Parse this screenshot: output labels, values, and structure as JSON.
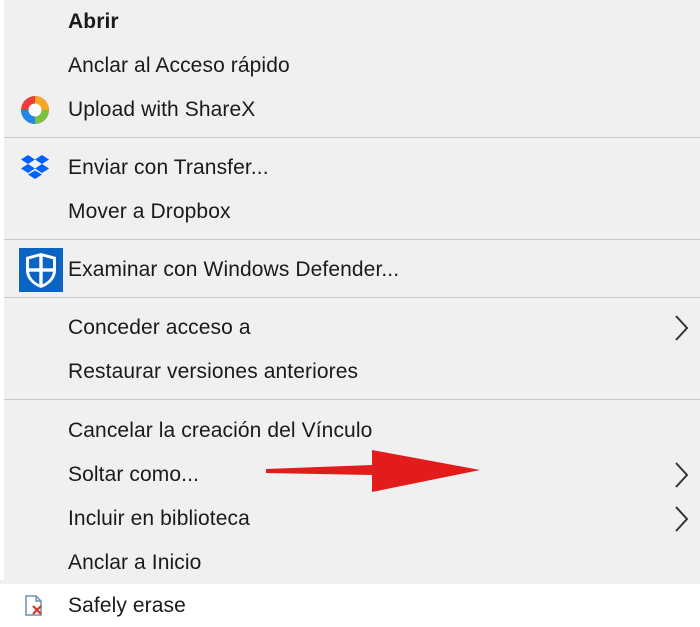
{
  "menu": {
    "items": [
      {
        "label": "Abrir"
      },
      {
        "label": "Anclar al Acceso rápido"
      },
      {
        "label": "Upload with ShareX",
        "icon": "sharex-icon"
      },
      {
        "label": "Enviar con Transfer...",
        "icon": "dropbox-icon"
      },
      {
        "label": "Mover a Dropbox"
      },
      {
        "label": "Examinar con Windows Defender...",
        "icon": "windows-defender-shield-icon"
      },
      {
        "label": "Conceder acceso a",
        "submenu": true
      },
      {
        "label": "Restaurar versiones anteriores"
      },
      {
        "label": "Cancelar la creación del Vínculo"
      },
      {
        "label": "Soltar como...",
        "submenu": true
      },
      {
        "label": "Incluir en biblioteca",
        "submenu": true
      },
      {
        "label": "Anclar a Inicio"
      },
      {
        "label": "Safely erase",
        "icon": "safely-erase-icon"
      }
    ]
  },
  "annotation": {
    "arrow_icon": "red-arrow-icon",
    "arrow_color": "#e21b1b"
  },
  "colors": {
    "menu_background": "#f0f0f0",
    "separator": "#c8c8c8",
    "text": "#1a1a1a",
    "dropbox_blue": "#0061fe",
    "defender_blue": "#0a64c2",
    "sharex_red": "#e8413b"
  }
}
